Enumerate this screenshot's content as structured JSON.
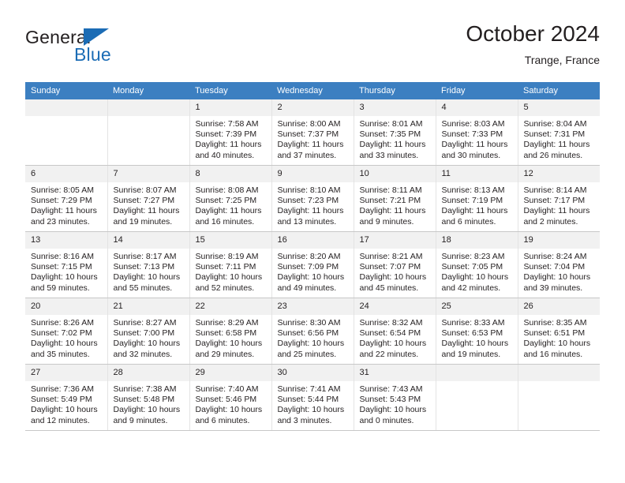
{
  "brand": {
    "name_line1": "General",
    "name_line2": "Blue",
    "logo_icon": "triangle-icon",
    "accent_color": "#1b6cb5"
  },
  "header": {
    "month_title": "October 2024",
    "location": "Trange, France"
  },
  "calendar": {
    "header_bg": "#3c7fc1",
    "daynum_bg": "#f1f1f1",
    "weekday_headers": [
      "Sunday",
      "Monday",
      "Tuesday",
      "Wednesday",
      "Thursday",
      "Friday",
      "Saturday"
    ],
    "labels": {
      "sunrise": "Sunrise:",
      "sunset": "Sunset:",
      "daylight": "Daylight:"
    },
    "weeks": [
      [
        {
          "blank": true
        },
        {
          "blank": true
        },
        {
          "day": "1",
          "sunrise": "Sunrise: 7:58 AM",
          "sunset": "Sunset: 7:39 PM",
          "daylight": "Daylight: 11 hours and 40 minutes."
        },
        {
          "day": "2",
          "sunrise": "Sunrise: 8:00 AM",
          "sunset": "Sunset: 7:37 PM",
          "daylight": "Daylight: 11 hours and 37 minutes."
        },
        {
          "day": "3",
          "sunrise": "Sunrise: 8:01 AM",
          "sunset": "Sunset: 7:35 PM",
          "daylight": "Daylight: 11 hours and 33 minutes."
        },
        {
          "day": "4",
          "sunrise": "Sunrise: 8:03 AM",
          "sunset": "Sunset: 7:33 PM",
          "daylight": "Daylight: 11 hours and 30 minutes."
        },
        {
          "day": "5",
          "sunrise": "Sunrise: 8:04 AM",
          "sunset": "Sunset: 7:31 PM",
          "daylight": "Daylight: 11 hours and 26 minutes."
        }
      ],
      [
        {
          "day": "6",
          "sunrise": "Sunrise: 8:05 AM",
          "sunset": "Sunset: 7:29 PM",
          "daylight": "Daylight: 11 hours and 23 minutes."
        },
        {
          "day": "7",
          "sunrise": "Sunrise: 8:07 AM",
          "sunset": "Sunset: 7:27 PM",
          "daylight": "Daylight: 11 hours and 19 minutes."
        },
        {
          "day": "8",
          "sunrise": "Sunrise: 8:08 AM",
          "sunset": "Sunset: 7:25 PM",
          "daylight": "Daylight: 11 hours and 16 minutes."
        },
        {
          "day": "9",
          "sunrise": "Sunrise: 8:10 AM",
          "sunset": "Sunset: 7:23 PM",
          "daylight": "Daylight: 11 hours and 13 minutes."
        },
        {
          "day": "10",
          "sunrise": "Sunrise: 8:11 AM",
          "sunset": "Sunset: 7:21 PM",
          "daylight": "Daylight: 11 hours and 9 minutes."
        },
        {
          "day": "11",
          "sunrise": "Sunrise: 8:13 AM",
          "sunset": "Sunset: 7:19 PM",
          "daylight": "Daylight: 11 hours and 6 minutes."
        },
        {
          "day": "12",
          "sunrise": "Sunrise: 8:14 AM",
          "sunset": "Sunset: 7:17 PM",
          "daylight": "Daylight: 11 hours and 2 minutes."
        }
      ],
      [
        {
          "day": "13",
          "sunrise": "Sunrise: 8:16 AM",
          "sunset": "Sunset: 7:15 PM",
          "daylight": "Daylight: 10 hours and 59 minutes."
        },
        {
          "day": "14",
          "sunrise": "Sunrise: 8:17 AM",
          "sunset": "Sunset: 7:13 PM",
          "daylight": "Daylight: 10 hours and 55 minutes."
        },
        {
          "day": "15",
          "sunrise": "Sunrise: 8:19 AM",
          "sunset": "Sunset: 7:11 PM",
          "daylight": "Daylight: 10 hours and 52 minutes."
        },
        {
          "day": "16",
          "sunrise": "Sunrise: 8:20 AM",
          "sunset": "Sunset: 7:09 PM",
          "daylight": "Daylight: 10 hours and 49 minutes."
        },
        {
          "day": "17",
          "sunrise": "Sunrise: 8:21 AM",
          "sunset": "Sunset: 7:07 PM",
          "daylight": "Daylight: 10 hours and 45 minutes."
        },
        {
          "day": "18",
          "sunrise": "Sunrise: 8:23 AM",
          "sunset": "Sunset: 7:05 PM",
          "daylight": "Daylight: 10 hours and 42 minutes."
        },
        {
          "day": "19",
          "sunrise": "Sunrise: 8:24 AM",
          "sunset": "Sunset: 7:04 PM",
          "daylight": "Daylight: 10 hours and 39 minutes."
        }
      ],
      [
        {
          "day": "20",
          "sunrise": "Sunrise: 8:26 AM",
          "sunset": "Sunset: 7:02 PM",
          "daylight": "Daylight: 10 hours and 35 minutes."
        },
        {
          "day": "21",
          "sunrise": "Sunrise: 8:27 AM",
          "sunset": "Sunset: 7:00 PM",
          "daylight": "Daylight: 10 hours and 32 minutes."
        },
        {
          "day": "22",
          "sunrise": "Sunrise: 8:29 AM",
          "sunset": "Sunset: 6:58 PM",
          "daylight": "Daylight: 10 hours and 29 minutes."
        },
        {
          "day": "23",
          "sunrise": "Sunrise: 8:30 AM",
          "sunset": "Sunset: 6:56 PM",
          "daylight": "Daylight: 10 hours and 25 minutes."
        },
        {
          "day": "24",
          "sunrise": "Sunrise: 8:32 AM",
          "sunset": "Sunset: 6:54 PM",
          "daylight": "Daylight: 10 hours and 22 minutes."
        },
        {
          "day": "25",
          "sunrise": "Sunrise: 8:33 AM",
          "sunset": "Sunset: 6:53 PM",
          "daylight": "Daylight: 10 hours and 19 minutes."
        },
        {
          "day": "26",
          "sunrise": "Sunrise: 8:35 AM",
          "sunset": "Sunset: 6:51 PM",
          "daylight": "Daylight: 10 hours and 16 minutes."
        }
      ],
      [
        {
          "day": "27",
          "sunrise": "Sunrise: 7:36 AM",
          "sunset": "Sunset: 5:49 PM",
          "daylight": "Daylight: 10 hours and 12 minutes."
        },
        {
          "day": "28",
          "sunrise": "Sunrise: 7:38 AM",
          "sunset": "Sunset: 5:48 PM",
          "daylight": "Daylight: 10 hours and 9 minutes."
        },
        {
          "day": "29",
          "sunrise": "Sunrise: 7:40 AM",
          "sunset": "Sunset: 5:46 PM",
          "daylight": "Daylight: 10 hours and 6 minutes."
        },
        {
          "day": "30",
          "sunrise": "Sunrise: 7:41 AM",
          "sunset": "Sunset: 5:44 PM",
          "daylight": "Daylight: 10 hours and 3 minutes."
        },
        {
          "day": "31",
          "sunrise": "Sunrise: 7:43 AM",
          "sunset": "Sunset: 5:43 PM",
          "daylight": "Daylight: 10 hours and 0 minutes."
        },
        {
          "blank": true
        },
        {
          "blank": true
        }
      ]
    ]
  }
}
